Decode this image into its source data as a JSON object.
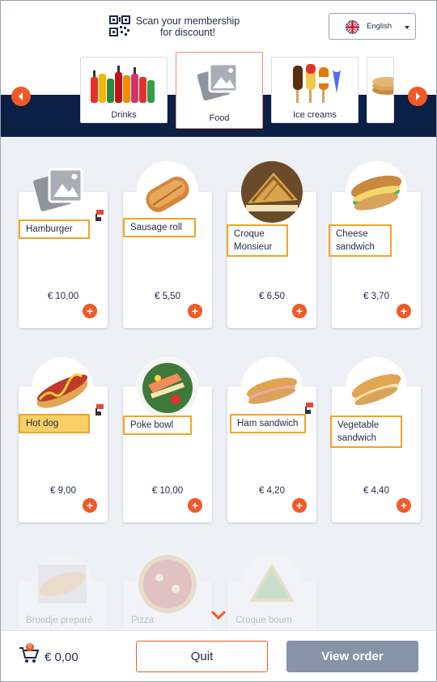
{
  "header": {
    "scan_line1": "Scan your membership",
    "scan_line2": "for discount!",
    "language": "English"
  },
  "categories": [
    {
      "label": "Drinks",
      "active": false
    },
    {
      "label": "Food",
      "active": true
    },
    {
      "label": "Ice creams",
      "active": false
    },
    {
      "label": "",
      "active": false
    }
  ],
  "products": [
    {
      "name": "Hamburger",
      "price": "€ 10,00",
      "image": "placeholder-image-icon"
    },
    {
      "name": "Sausage roll",
      "price": "€ 5,50",
      "image": "sausage-roll"
    },
    {
      "name": "Croque Monsieur",
      "price": "€ 6,50",
      "image": "croque-monsieur"
    },
    {
      "name": "Cheese sandwich",
      "price": "€ 3,70",
      "image": "cheese-sandwich"
    },
    {
      "name": "Hot dog",
      "price": "€ 9,00",
      "image": "hot-dog"
    },
    {
      "name": "Poke bowl",
      "price": "€ 10,00",
      "image": "poke-bowl"
    },
    {
      "name": "Ham sandwich",
      "price": "€ 4,20",
      "image": "ham-sandwich"
    },
    {
      "name": "Vegetable sandwich",
      "price": "€ 4,40",
      "image": "vegetable-sandwich"
    },
    {
      "name": "Broodje preparé",
      "price": "",
      "image": "broodje"
    },
    {
      "name": "Pizza",
      "price": "",
      "image": "pizza"
    },
    {
      "name": "Croque boum",
      "price": "",
      "image": "croque-boum"
    }
  ],
  "footer": {
    "cart_count": "0",
    "total": "€ 0,00",
    "quit_label": "Quit",
    "view_order_label": "View order"
  },
  "colors": {
    "accent": "#f05a28",
    "navy": "#0c1f45",
    "highlight_border": "#f0a526",
    "highlight_fill": "#f9cf66",
    "view_order_bg": "#8793a6"
  }
}
